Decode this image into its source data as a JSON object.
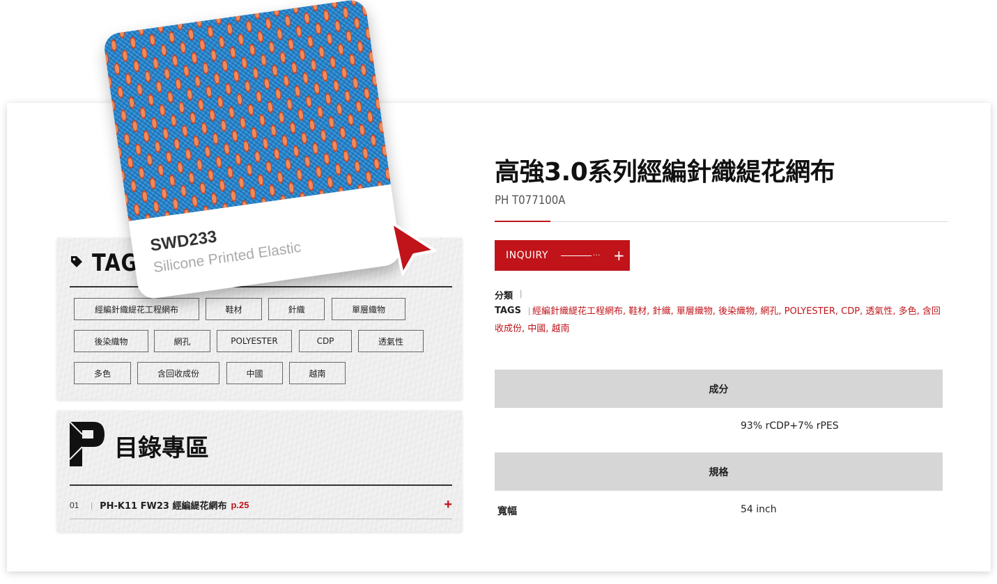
{
  "fabric_card": {
    "code": "SWD233",
    "name": "Silicone Printed Elastic"
  },
  "tag_panel": {
    "heading": "TAG",
    "chips": [
      "經編針織緹花工程網布",
      "鞋材",
      "針織",
      "單層織物",
      "後染織物",
      "網孔",
      "POLYESTER",
      "CDP",
      "透氣性",
      "多色",
      "含回收成份",
      "中國",
      "越南"
    ]
  },
  "catalog_panel": {
    "heading": "目錄專區",
    "items": [
      {
        "num": "01",
        "name": "PH-K11 FW23 經編緹花網布",
        "page": "p.25"
      }
    ]
  },
  "product": {
    "title": "高強3.0系列經編針織緹花網布",
    "code": "PH T077100A",
    "inquiry_label": "INQUIRY",
    "category_label": "分類",
    "tags_label": "TAGS",
    "tags": [
      "經編針織緹花工程網布",
      "鞋材",
      "針織",
      "單層織物",
      "後染織物",
      "網孔",
      "POLYESTER",
      "CDP",
      "透氣性",
      "多色",
      "含回收成份",
      "中國",
      "越南"
    ]
  },
  "specs": {
    "composition_head": "成分",
    "composition_value": "93% rCDP+7% rPES",
    "spec_head": "規格",
    "width_label": "寬幅",
    "width_value": "54 inch"
  },
  "colors": {
    "accent": "#c0141a",
    "spec_header_bg": "#d6d6d6",
    "panel_bg": "#eeeeee"
  }
}
